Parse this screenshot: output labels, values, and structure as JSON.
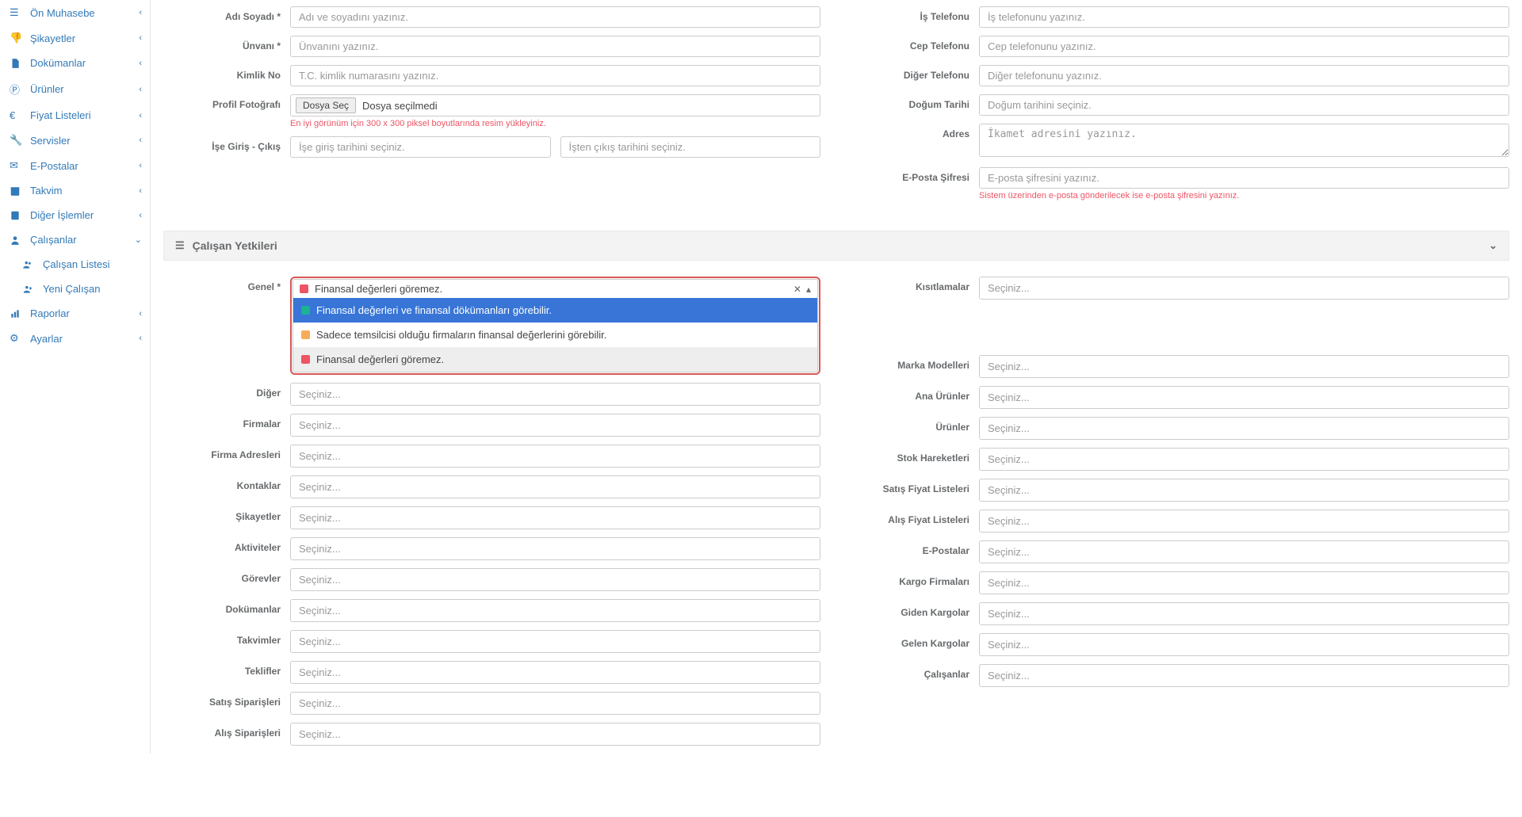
{
  "sidebar": {
    "items": [
      {
        "label": "Ön Muhasebe"
      },
      {
        "label": "Şikayetler"
      },
      {
        "label": "Dokümanlar"
      },
      {
        "label": "Ürünler"
      },
      {
        "label": "Fiyat Listeleri"
      },
      {
        "label": "Servisler"
      },
      {
        "label": "E-Postalar"
      },
      {
        "label": "Takvim"
      },
      {
        "label": "Diğer İşlemler"
      },
      {
        "label": "Çalışanlar"
      },
      {
        "label": "Raporlar"
      },
      {
        "label": "Ayarlar"
      }
    ],
    "sub": [
      {
        "label": "Çalışan Listesi"
      },
      {
        "label": "Yeni Çalışan"
      }
    ]
  },
  "form": {
    "labels": {
      "fullname": "Adı Soyadı *",
      "title": "Ünvanı *",
      "idno": "Kimlik No",
      "photo": "Profil Fotoğrafı",
      "inout": "İşe Giriş - Çıkış",
      "workphone": "İş Telefonu",
      "mobile": "Cep Telefonu",
      "other": "Diğer Telefonu",
      "birth": "Doğum Tarihi",
      "address": "Adres",
      "emailpw": "E-Posta Şifresi"
    },
    "placeholders": {
      "fullname": "Adı ve soyadını yazınız.",
      "title": "Ünvanını yazınız.",
      "idno": "T.C. kimlik numarasını yazınız.",
      "datein": "İşe giriş tarihini seçiniz.",
      "dateout": "İşten çıkış tarihini seçiniz.",
      "workphone": "İş telefonunu yazınız.",
      "mobile": "Cep telefonunu yazınız.",
      "other": "Diğer telefonunu yazınız.",
      "birth": "Doğum tarihini seçiniz.",
      "address": "İkamet adresini yazınız.",
      "emailpw": "E-posta şifresini yazınız."
    },
    "file": {
      "button": "Dosya Seç",
      "none": "Dosya seçilmedi"
    },
    "hints": {
      "photo": "En iyi görünüm için 300 x 300 piksel boyutlarında resim yükleyiniz.",
      "emailpw": "Sistem üzerinden e-posta gönderilecek ise e-posta şifresini yazınız."
    }
  },
  "panel": {
    "title": "Çalışan Yetkileri"
  },
  "perm": {
    "genel_label": "Genel *",
    "selected": "Finansal değerleri göremez.",
    "opts": [
      "Finansal değerleri ve finansal dökümanları görebilir.",
      "Sadece temsilcisi olduğu firmaların finansal değerlerini görebilir.",
      "Finansal değerleri göremez."
    ],
    "select_placeholder": "Seçiniz...",
    "left": [
      "Diğer",
      "Firmalar",
      "Firma Adresleri",
      "Kontaklar",
      "Şikayetler",
      "Aktiviteler",
      "Görevler",
      "Dokümanlar",
      "Takvimler",
      "Teklifler",
      "Satış Siparişleri",
      "Alış Siparişleri"
    ],
    "right": [
      "Kısıtlamalar",
      "Marka Modelleri",
      "Ana Ürünler",
      "Ürünler",
      "Stok Hareketleri",
      "Satış Fiyat Listeleri",
      "Alış Fiyat Listeleri",
      "E-Postalar",
      "Kargo Firmaları",
      "Giden Kargolar",
      "Gelen Kargolar",
      "Çalışanlar"
    ]
  }
}
